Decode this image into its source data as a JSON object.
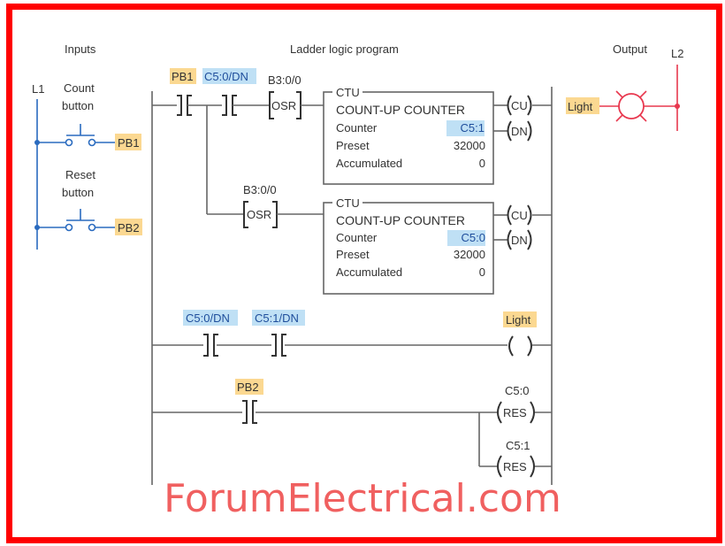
{
  "headings": {
    "inputs": "Inputs",
    "program": "Ladder logic program",
    "output": "Output"
  },
  "rails": {
    "l1": "L1",
    "l2": "L2"
  },
  "inputs": [
    {
      "label_line1": "Count",
      "label_line2": "button",
      "tag": "PB1"
    },
    {
      "label_line1": "Reset",
      "label_line2": "button",
      "tag": "PB2"
    }
  ],
  "output_device": {
    "tag": "Light",
    "icon": "lamp-icon"
  },
  "rungs": {
    "rung1": {
      "contacts": [
        "PB1",
        "C5:0/DN"
      ],
      "osr_addr": "B3:0/0",
      "osr_label": "OSR",
      "counter": {
        "type": "CTU",
        "title": "COUNT-UP COUNTER",
        "rows": [
          {
            "label": "Counter",
            "value": "C5:1"
          },
          {
            "label": "Preset",
            "value": "32000"
          },
          {
            "label": "Accumulated",
            "value": "0"
          }
        ]
      },
      "coils": [
        "CU",
        "DN"
      ]
    },
    "rung1_branch": {
      "osr_addr": "B3:0/0",
      "osr_label": "OSR",
      "counter": {
        "type": "CTU",
        "title": "COUNT-UP COUNTER",
        "rows": [
          {
            "label": "Counter",
            "value": "C5:0"
          },
          {
            "label": "Preset",
            "value": "32000"
          },
          {
            "label": "Accumulated",
            "value": "0"
          }
        ]
      },
      "coils": [
        "CU",
        "DN"
      ]
    },
    "rung2": {
      "contacts": [
        "C5:0/DN",
        "C5:1/DN"
      ],
      "coil_tag": "Light",
      "coil_symbol": "( )"
    },
    "rung3": {
      "contact": "PB2",
      "coils": [
        {
          "addr": "C5:0",
          "label": "RES"
        },
        {
          "addr": "C5:1",
          "label": "RES"
        }
      ]
    }
  },
  "watermark": "ForumElectrical.com",
  "colors": {
    "frame": "#ff0000",
    "input_wiring": "#2a6bbf",
    "output_wiring": "#e8384f",
    "tag_input_highlight": "#fbd891",
    "tag_bit_highlight": "#bfe0f5",
    "watermark": "#f06060"
  }
}
